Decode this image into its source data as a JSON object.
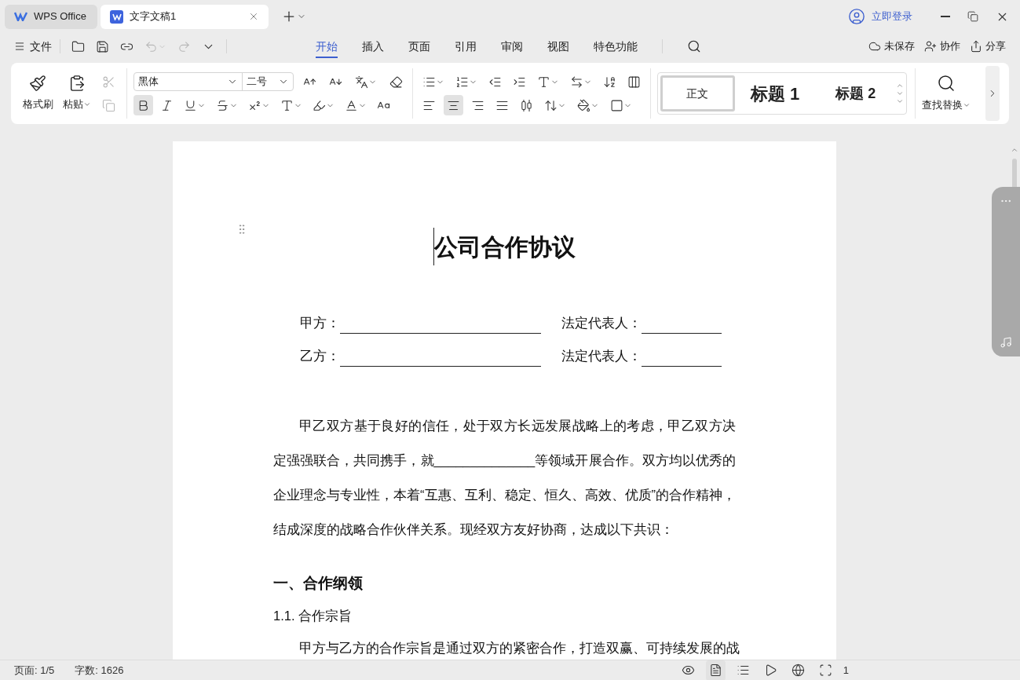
{
  "tabs": [
    {
      "kind": "home",
      "label": "WPS Office",
      "selected": false
    },
    {
      "kind": "doc",
      "label": "文字文稿1",
      "selected": true
    }
  ],
  "login": "立即登录",
  "menu": {
    "file": "文件",
    "undo": {
      "disabled": true
    },
    "redo": {
      "disabled": true
    },
    "tabs": [
      {
        "label": "开始",
        "selected": true
      },
      {
        "label": "插入",
        "selected": false
      },
      {
        "label": "页面",
        "selected": false
      },
      {
        "label": "引用",
        "selected": false
      },
      {
        "label": "审阅",
        "selected": false
      },
      {
        "label": "视图",
        "selected": false
      },
      {
        "label": "特色功能",
        "selected": false
      }
    ],
    "actions": [
      {
        "kind": "cloud",
        "label": "未保存"
      },
      {
        "kind": "collab",
        "label": "协作"
      },
      {
        "kind": "share",
        "label": "分享"
      }
    ]
  },
  "ribbon": {
    "format_painter": "格式刷",
    "paste": "粘贴",
    "cut": {
      "disabled": true
    },
    "copy": {
      "disabled": true
    },
    "font": "黑体",
    "size": "二号",
    "text_styles": [
      {
        "kind": "bold",
        "selected": true
      },
      {
        "kind": "italic",
        "selected": false
      }
    ],
    "alignment": [
      {
        "kind": "left",
        "selected": false
      },
      {
        "kind": "center",
        "selected": true
      },
      {
        "kind": "right",
        "selected": false
      },
      {
        "kind": "justify",
        "selected": false
      },
      {
        "kind": "distribute",
        "selected": false
      }
    ],
    "styles": [
      {
        "label": "正文",
        "kind": "body",
        "selected": true
      },
      {
        "label": "标题 1",
        "kind": "h1",
        "selected": false
      },
      {
        "label": "标题 2",
        "kind": "h2",
        "selected": false
      }
    ],
    "find": "查找替换"
  },
  "document": {
    "title": "公司合作协议",
    "parties": [
      {
        "label": "甲方：",
        "rep": "法定代表人："
      },
      {
        "label": "乙方：",
        "rep": "法定代表人："
      }
    ],
    "paragraph": "甲乙双方基于良好的信任，处于双方长远发展战略上的考虑，甲乙双方决定强强联合，共同携手，就______________等领域开展合作。双方均以优秀的企业理念与专业性，本着“互惠、互利、稳定、恒久、高效、优质”的合作精神，结成深度的战略合作伙伴关系。现经双方友好协商，达成以下共识：",
    "heading": "一、合作纲领",
    "subheading": "1.1. 合作宗旨",
    "last_line": "甲方与乙方的合作宗旨是通过双方的紧密合作，打造双赢、可持续发展的战"
  },
  "status_bar": {
    "page": "页面: 1/5",
    "words": "字数: 1626",
    "zoom": "1"
  }
}
